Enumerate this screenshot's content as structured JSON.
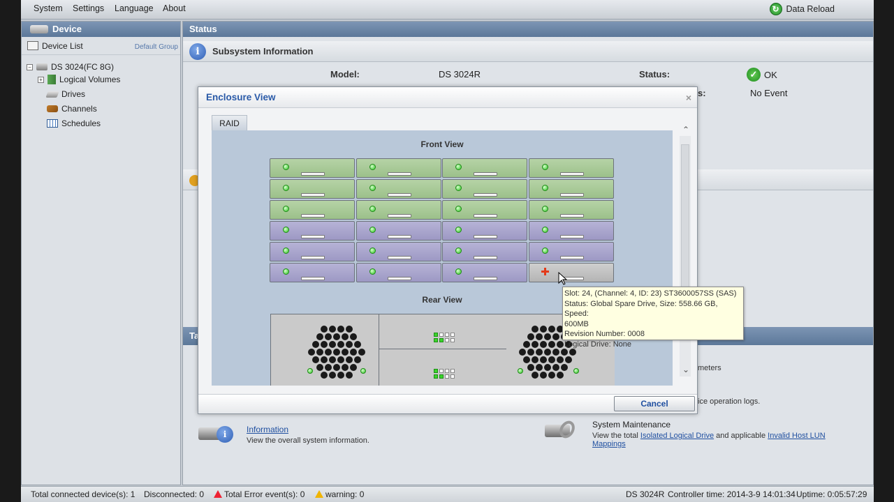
{
  "menubar": {
    "items": [
      "System",
      "Settings",
      "Language",
      "About"
    ],
    "data_reload": "Data Reload"
  },
  "left_panel": {
    "title": "Device",
    "device_list": "Device List",
    "default_group": "Default Group",
    "tree": {
      "device": "DS 3024(FC 8G)",
      "logical_volumes": "Logical Volumes",
      "drives": "Drives",
      "channels": "Channels",
      "schedules": "Schedules"
    }
  },
  "status_panel": {
    "title": "Status",
    "subsystem_title": "Subsystem Information",
    "model_label": "Model:",
    "model_value": "DS 3024R",
    "status_label": "Status:",
    "status_value": "OK",
    "event_label_partial": "s:",
    "event_value": "No Event",
    "bar_label_partial": "Ta",
    "partial_text_1": "meters",
    "partial_text_2": "ice operation logs."
  },
  "bottom_items": {
    "information_link": "Information",
    "information_desc": "View the overall system information.",
    "maintenance_title": "System Maintenance",
    "maintenance_desc_pre": "View the total",
    "isolated_link": "Isolated Logical Drive",
    "maintenance_desc_mid": "and applicable",
    "invalid_link": "Invalid Host LUN",
    "invalid_link_2": "Mappings"
  },
  "modal": {
    "title": "Enclosure View",
    "close": "×",
    "tab": "RAID",
    "front_view": "Front View",
    "rear_view": "Rear View",
    "cancel": "Cancel",
    "drive_rows": [
      [
        "green",
        "green",
        "green",
        "green"
      ],
      [
        "green",
        "green",
        "green",
        "green"
      ],
      [
        "green",
        "green",
        "green",
        "green"
      ],
      [
        "purple",
        "purple",
        "purple",
        "purple"
      ],
      [
        "purple",
        "purple",
        "purple",
        "purple"
      ],
      [
        "purple",
        "purple",
        "purple",
        "spare"
      ]
    ]
  },
  "tooltip": {
    "line1": "Slot: 24, (Channel: 4, ID: 23) ST3600057SS   (SAS)",
    "line2": "Status: Global Spare Drive, Size: 558.66 GB, Speed:",
    "line3": "600MB",
    "line4": "Revision Number: 0008",
    "line5": "Logical Drive: None"
  },
  "statusbar": {
    "connected": "Total connected device(s): 1",
    "disconnected": "Disconnected: 0",
    "errors": "Total Error event(s): 0",
    "warning": "warning: 0",
    "model": "DS 3024R",
    "controller_time": "Controller time: 2014-3-9 14:01:34",
    "uptime": "Uptime: 0:05:57:29"
  },
  "colors": {
    "header_blue": "#5c7899",
    "drive_green": "#9cc08a",
    "drive_purple": "#9d98c4",
    "link_blue": "#1f4fa0"
  }
}
